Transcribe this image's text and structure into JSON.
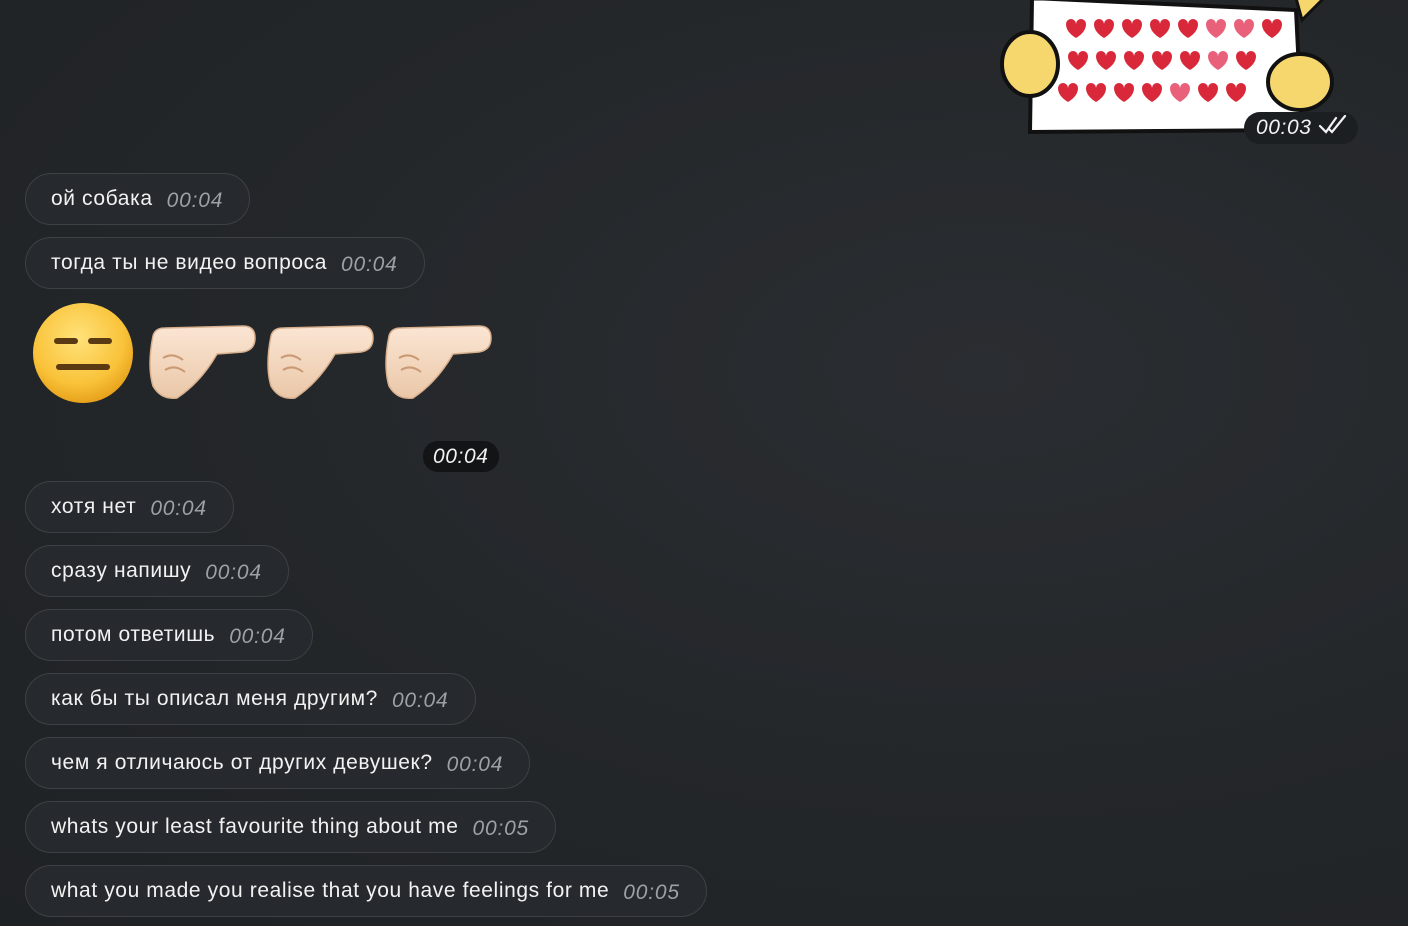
{
  "sticker": {
    "icon": "hearts-letter-sticker",
    "time": "00:03",
    "status_icon": "double-check-icon"
  },
  "messages": [
    {
      "text": "ой собака",
      "time": "00:04"
    },
    {
      "text": "тогда ты не видео вопроса",
      "time": "00:04"
    }
  ],
  "emoji_message": {
    "emojis": [
      "expressionless-face",
      "right-facing-fist",
      "right-facing-fist",
      "right-facing-fist"
    ],
    "time": "00:04"
  },
  "messages_after": [
    {
      "text": "хотя нет",
      "time": "00:04"
    },
    {
      "text": "сразу напишу",
      "time": "00:04"
    },
    {
      "text": "потом ответишь",
      "time": "00:04"
    },
    {
      "text": "как бы ты описал меня другим?",
      "time": "00:04"
    },
    {
      "text": "чем я отличаюсь от других девушек?",
      "time": "00:04"
    },
    {
      "text": "whats your least favourite thing about me",
      "time": "00:05"
    },
    {
      "text": "what you made you realise that you have feelings for me",
      "time": "00:05"
    }
  ],
  "colors": {
    "background": "#24272b",
    "bubble": "#26292d",
    "bubble_border": "#3d4045",
    "time_text": "#9da1a7"
  }
}
